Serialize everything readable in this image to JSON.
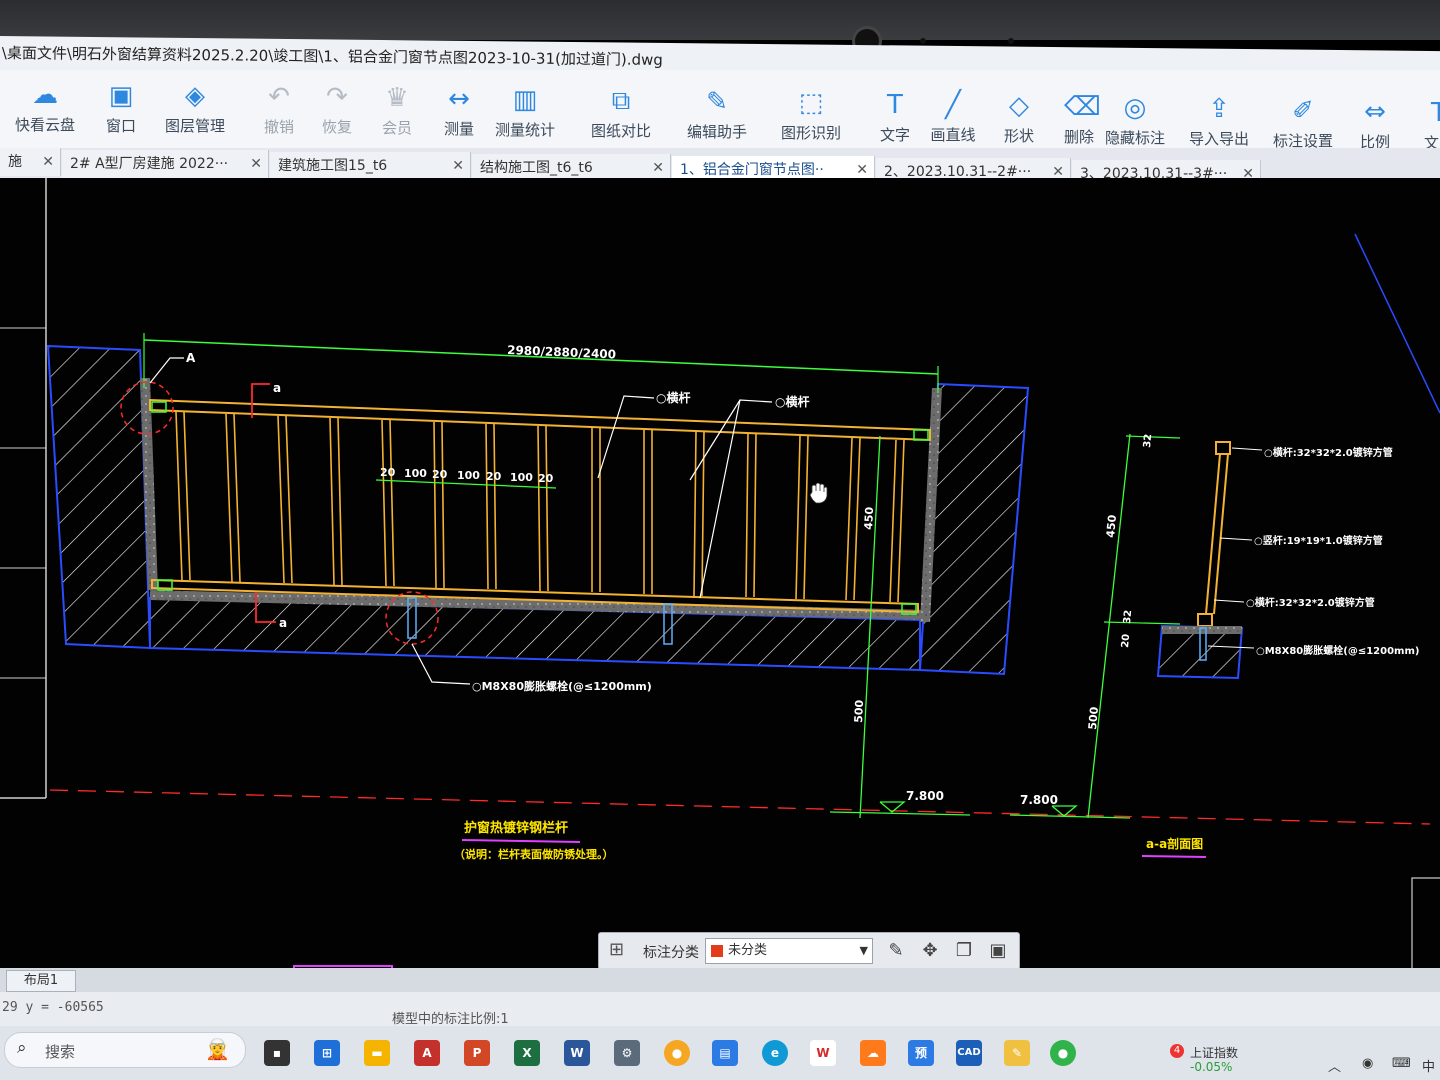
{
  "window": {
    "title": "\\桌面文件\\明石外窗结算资料2025.2.20\\竣工图\\1、铝合金门窗节点图2023-10-31(加过道门).dwg"
  },
  "ribbon": {
    "items": [
      {
        "label": "快看云盘",
        "icon": "cloud-icon",
        "enabled": true
      },
      {
        "label": "窗口",
        "icon": "window-icon",
        "enabled": true
      },
      {
        "label": "图层管理",
        "icon": "layers-icon",
        "enabled": true
      },
      {
        "label": "撤销",
        "icon": "undo-icon",
        "enabled": false
      },
      {
        "label": "恢复",
        "icon": "redo-icon",
        "enabled": false
      },
      {
        "label": "会员",
        "icon": "vip-icon",
        "enabled": false
      },
      {
        "label": "测量",
        "icon": "ruler-icon",
        "enabled": true
      },
      {
        "label": "测量统计",
        "icon": "chart-icon",
        "enabled": true
      },
      {
        "label": "图纸对比",
        "icon": "compare-icon",
        "enabled": true
      },
      {
        "label": "编辑助手",
        "icon": "edit-assistant-icon",
        "enabled": true
      },
      {
        "label": "图形识别",
        "icon": "shape-recognize-icon",
        "enabled": true
      },
      {
        "label": "文字",
        "icon": "text-icon",
        "enabled": true
      },
      {
        "label": "画直线",
        "icon": "line-icon",
        "enabled": true
      },
      {
        "label": "形状",
        "icon": "shape-icon",
        "enabled": true
      },
      {
        "label": "删除",
        "icon": "eraser-icon",
        "enabled": true
      },
      {
        "label": "隐藏标注",
        "icon": "hide-annotation-icon",
        "enabled": true
      },
      {
        "label": "导入导出",
        "icon": "import-export-icon",
        "enabled": true
      },
      {
        "label": "标注设置",
        "icon": "annotation-settings-icon",
        "enabled": true
      },
      {
        "label": "比例",
        "icon": "scale-icon",
        "enabled": true
      },
      {
        "label": "文字",
        "icon": "text-icon",
        "enabled": true
      }
    ]
  },
  "tabs": [
    {
      "label": "施",
      "active": false
    },
    {
      "label": "2# A型厂房建施 2022···",
      "active": false
    },
    {
      "label": "建筑施工图15_t6",
      "active": false
    },
    {
      "label": "结构施工图_t6_t6",
      "active": false
    },
    {
      "label": "1、铝合金门窗节点图··",
      "active": true
    },
    {
      "label": "2、2023.10.31--2#···",
      "active": false
    },
    {
      "label": "3、2023.10.31--3#···",
      "active": false
    }
  ],
  "drawing": {
    "top_dim": "2980/2880/2400",
    "label_A": "A",
    "label_a1": "a",
    "label_a2": "a",
    "rail_label_1": "○横杆",
    "rail_label_2": "○横杆",
    "spacing_dims": [
      "20",
      "100",
      "20",
      "100",
      "20",
      "100",
      "20"
    ],
    "height_dim": "450",
    "lower_dim": "500",
    "elev_left": "7.800",
    "elev_right": "7.800",
    "bolt_note": "○M8X80膨胀螺栓(@≤1200mm)",
    "main_title": "护窗热镀锌钢栏杆",
    "main_note": "（说明：栏杆表面做防锈处理。）",
    "section_title": "a-a剖面图",
    "section_dims": {
      "top": "32",
      "mid": "450",
      "a": "32",
      "b": "20",
      "bottom": "500"
    },
    "section_labels": [
      "○横杆:32*32*2.0镀锌方管",
      "○竖杆:19*19*1.0镀锌方管",
      "○横杆:32*32*2.0镀锌方管",
      "○M8X80膨胀螺栓(@≤1200mm)"
    ]
  },
  "float_toolbar": {
    "label": "标注分类",
    "selected": "未分类",
    "swatch_color": "#e43b1a"
  },
  "layout_tab": "布局1",
  "status": {
    "coords": "29 y = -60565",
    "scale_text": "模型中的标注比例:1"
  },
  "taskbar": {
    "search_placeholder": "搜索",
    "stock_name": "上证指数",
    "stock_change": "-0.05%",
    "stock_badge": "4",
    "ime": "中"
  }
}
